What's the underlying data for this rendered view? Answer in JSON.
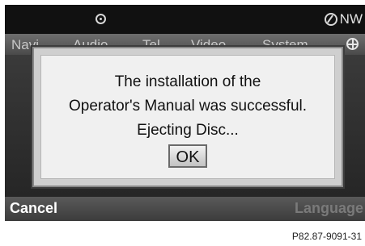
{
  "status_bar": {
    "disc_icon": "disc-icon",
    "compass_icon": "compass-icon",
    "heading": "NW"
  },
  "menu": {
    "items": [
      "Navi",
      "Audio",
      "Tel",
      "Video",
      "System"
    ],
    "globe_icon": "globe-icon"
  },
  "dialog": {
    "line1": "The installation of the",
    "line2": "Operator's Manual was successful.",
    "line3": "Ejecting Disc...",
    "ok_label": "OK"
  },
  "bottom_bar": {
    "cancel_label": "Cancel",
    "language_label": "Language"
  },
  "figure_code": "P82.87-9091-31"
}
